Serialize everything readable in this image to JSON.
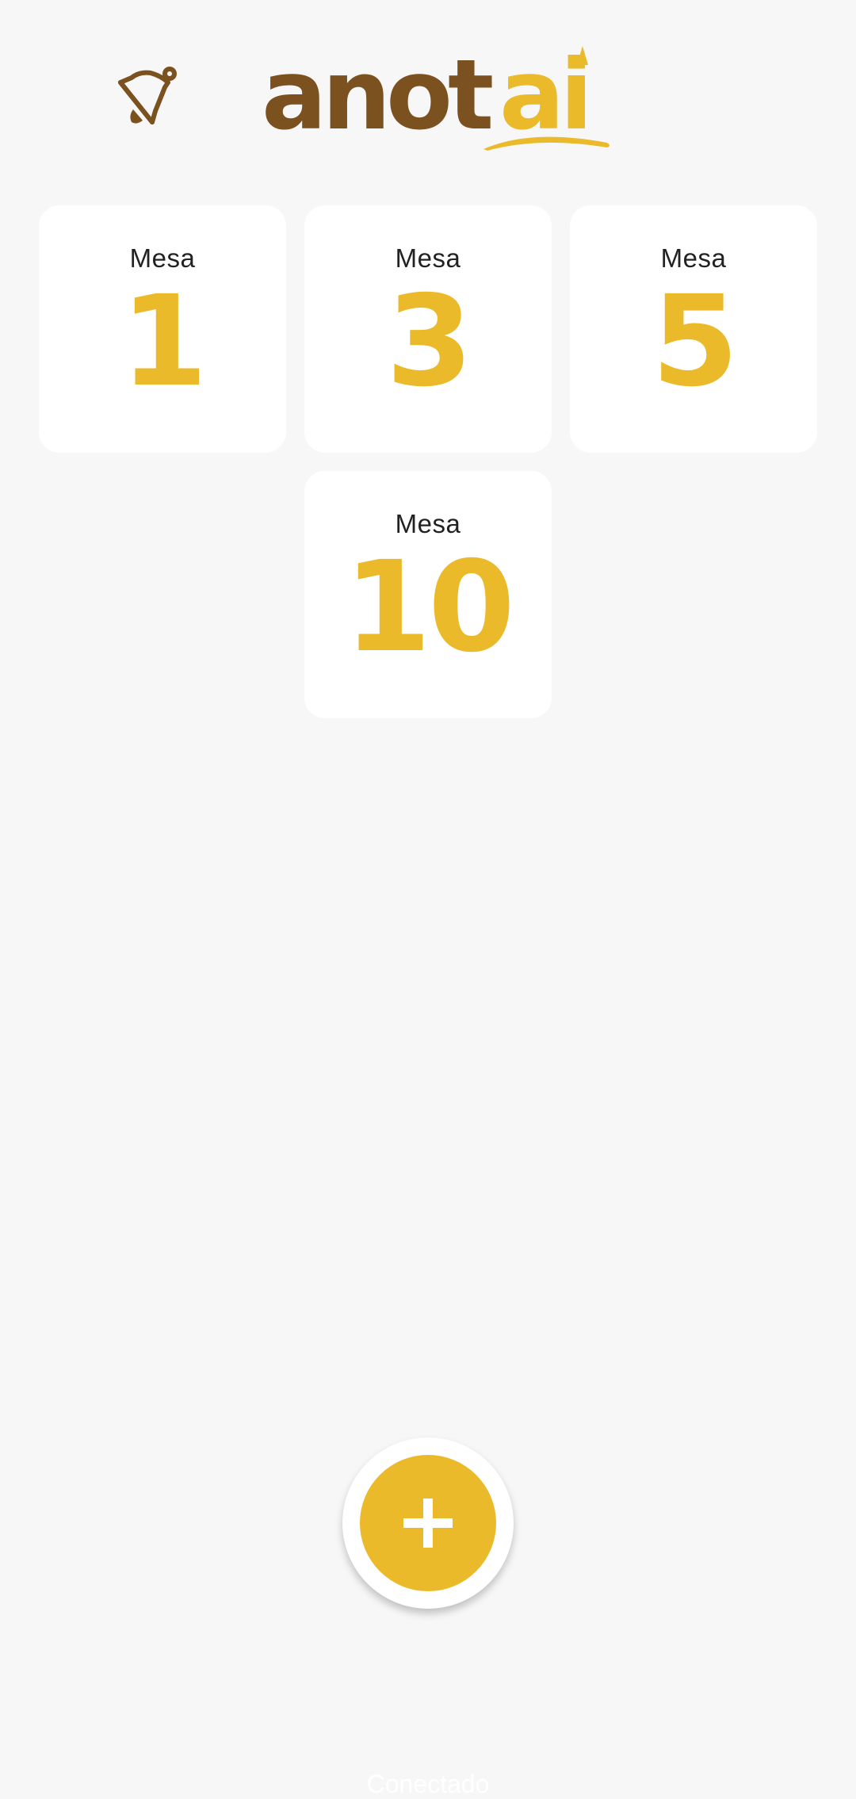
{
  "header": {
    "bell_icon": "bell-icon",
    "logo_text_dark": "anot",
    "logo_text_accent": "ai"
  },
  "tables": {
    "items": [
      {
        "label": "Mesa",
        "number": "1"
      },
      {
        "label": "Mesa",
        "number": "3"
      },
      {
        "label": "Mesa",
        "number": "5"
      },
      {
        "label": "Mesa",
        "number": "10"
      }
    ]
  },
  "fab": {
    "icon": "plus-icon"
  },
  "footer": {
    "status_text": "Conectado"
  },
  "colors": {
    "brand_brown": "#7b5120",
    "brand_yellow": "#ebba2a",
    "background": "#f7f7f7",
    "card": "#ffffff"
  }
}
